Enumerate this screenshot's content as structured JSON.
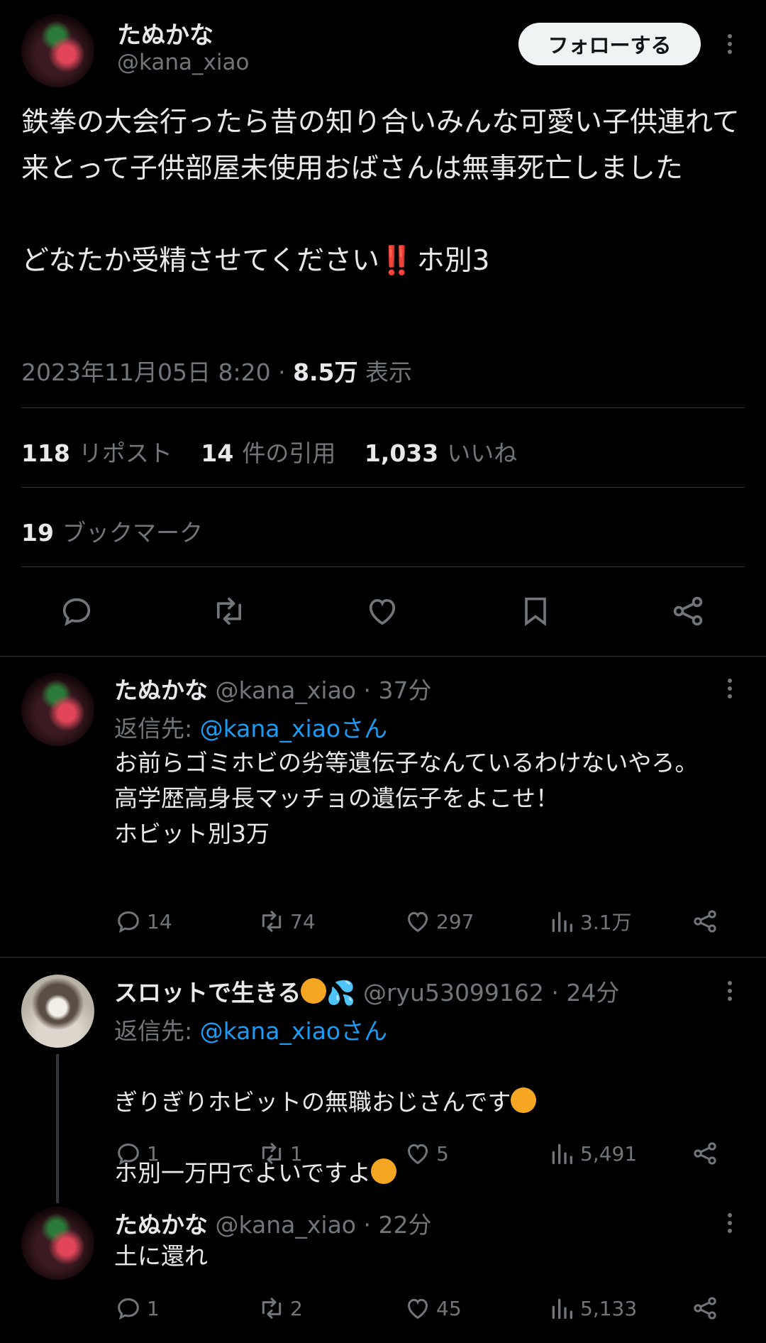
{
  "main_post": {
    "display_name": "たぬかな",
    "handle": "@kana_xiao",
    "follow_label": "フォローする",
    "text": "鉄拳の大会行ったら昔の知り合いみんな可愛い子供連れて来とって子供部屋未使用おばさんは無事死亡しました\n\nどなたか受精させてください",
    "text_emoji": "‼️",
    "text_tail": "ホ別3",
    "timestamp": "2023年11月05日 8:20",
    "separator": "·",
    "views": "8.5万",
    "views_label": "表示",
    "reposts": "118",
    "reposts_label": "リポスト",
    "quotes": "14",
    "quotes_label": "件の引用",
    "likes": "1,033",
    "likes_label": "いいね",
    "bookmarks": "19",
    "bookmarks_label": "ブックマーク"
  },
  "replies": [
    {
      "display_name": "たぬかな",
      "handle": "@kana_xiao",
      "sep": "·",
      "time": "37分",
      "reply_prefix": "返信先: ",
      "reply_to": "@kana_xiaoさん",
      "text": "お前らゴミホビの劣等遺伝子なんているわけないやろ。\n高学歴高身長マッチョの遺伝子をよこせ！\nホビット別3万",
      "replies": "14",
      "reposts": "74",
      "likes": "297",
      "views": "3.1万"
    },
    {
      "display_name": "スロットで生きる",
      "name_emoji": "💦",
      "handle": "@ryu53099162",
      "sep": "·",
      "time": "24分",
      "reply_prefix": "返信先: ",
      "reply_to": "@kana_xiaoさん",
      "text_line1": "ぎりぎりホビットの無職おじさんです",
      "text_line2": "ホ別一万円でよいですよ",
      "replies": "1",
      "reposts": "1",
      "likes": "5",
      "views": "5,491"
    },
    {
      "display_name": "たぬかな",
      "handle": "@kana_xiao",
      "sep": "·",
      "time": "22分",
      "text": "土に還れ",
      "replies": "1",
      "reposts": "2",
      "likes": "45",
      "views": "5,133"
    }
  ],
  "icons": {
    "reply": "speech-bubble-icon",
    "repost": "repost-arrows-icon",
    "like": "heart-icon",
    "bookmark": "bookmark-icon",
    "share": "share-icon",
    "views": "bar-chart-icon",
    "more": "more-vertical-icon"
  },
  "colors": {
    "background": "#000000",
    "text": "#e7e9ea",
    "secondary": "#71767b",
    "link": "#1d9bf0",
    "follow_button_bg": "#eff3f4"
  }
}
